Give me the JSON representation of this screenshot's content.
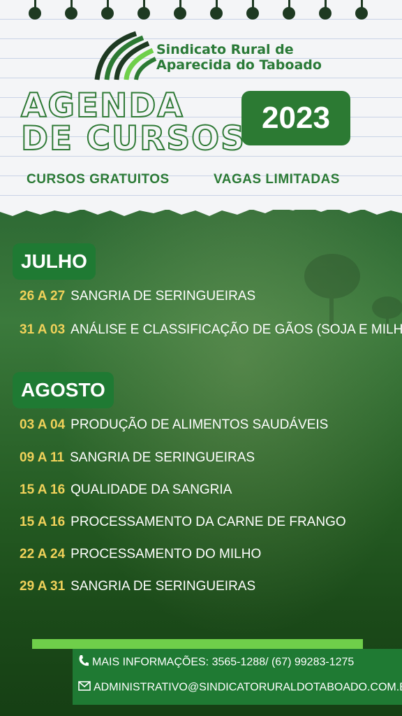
{
  "header": {
    "org_line1": "Sindicato Rural de",
    "org_line2": "Aparecida do Taboado",
    "title_line1": "AGENDA",
    "title_line2": "DE CURSOS",
    "year": "2023",
    "tag_left": "CURSOS GRATUITOS",
    "tag_right": "VAGAS LIMITADAS"
  },
  "months": [
    {
      "name": "JULHO",
      "courses": [
        {
          "date": "26 A 27",
          "title": "SANGRIA DE SERINGUEIRAS"
        },
        {
          "date": "31 A 03",
          "title": "ANÁLISE E CLASSIFICAÇÃO DE GÃOS (SOJA E MILHO)"
        }
      ]
    },
    {
      "name": "AGOSTO",
      "courses": [
        {
          "date": "03 A 04",
          "title": "PRODUÇÃO DE ALIMENTOS SAUDÁVEIS"
        },
        {
          "date": "09 A 11",
          "title": "SANGRIA DE SERINGUEIRAS"
        },
        {
          "date": "15 A 16",
          "title": "QUALIDADE DA SANGRIA"
        },
        {
          "date": "15 A 16",
          "title": "PROCESSAMENTO DA CARNE DE FRANGO"
        },
        {
          "date": "22 A 24",
          "title": "PROCESSAMENTO DO MILHO"
        },
        {
          "date": "29 A 31",
          "title": "SANGRIA DE SERINGUEIRAS"
        }
      ]
    }
  ],
  "contact": {
    "phone_text": "MAIS INFORMAÇÕES: 3565-1288/ (67) 99283-1275",
    "email_text": "ADMINISTRATIVO@SINDICATORURALDOTABOADO.COM.BR",
    "phone_icon": "phone-icon",
    "email_icon": "mail-icon"
  },
  "colors": {
    "brand_green": "#2c7a33",
    "date_yellow": "#f1d25a",
    "accent_light_green": "#6fcf4a"
  }
}
